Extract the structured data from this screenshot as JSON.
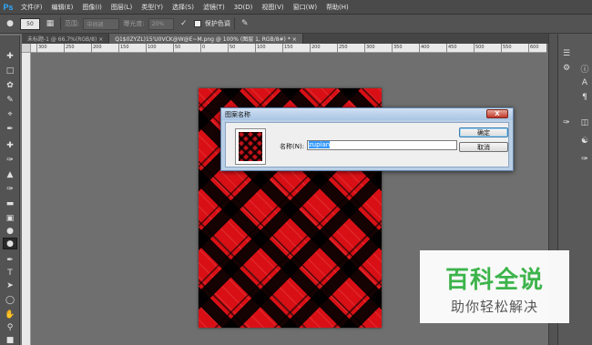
{
  "app": {
    "logo": "Ps"
  },
  "menu": [
    "文件(F)",
    "编辑(E)",
    "图像(I)",
    "图层(L)",
    "类型(Y)",
    "选择(S)",
    "滤镜(T)",
    "3D(D)",
    "视图(V)",
    "窗口(W)",
    "帮助(H)"
  ],
  "options": {
    "brush_size": "50",
    "range_label": "范围:",
    "range_value": "中间调",
    "exposure_label": "曝光度:",
    "exposure_value": "20%",
    "protect_tone_label": "保护色调"
  },
  "tabs": [
    "未标题-1 @ 66.7%(RGB/8)",
    "Q1$0ZYZL)15'U0VCK@W@E~M.png @ 100% (图层 1, RGB/8#) *"
  ],
  "ruler": {
    "labels": [
      "300",
      "250",
      "200",
      "150",
      "100",
      "50",
      "0",
      "50",
      "100",
      "150",
      "200",
      "250",
      "300",
      "350",
      "400",
      "450",
      "500",
      "550",
      "600"
    ]
  },
  "dialog": {
    "title": "图案名称",
    "close": "X",
    "name_label": "名称(N):",
    "name_value": "zupian",
    "ok_label": "确定",
    "cancel_label": "取消"
  },
  "watermark": {
    "title": "百科全说",
    "subtitle": "助你轻松解决"
  },
  "colors": {
    "pattern_red": "#d81016",
    "pattern_black": "#000000",
    "watermark_green": "#3bb74a"
  }
}
